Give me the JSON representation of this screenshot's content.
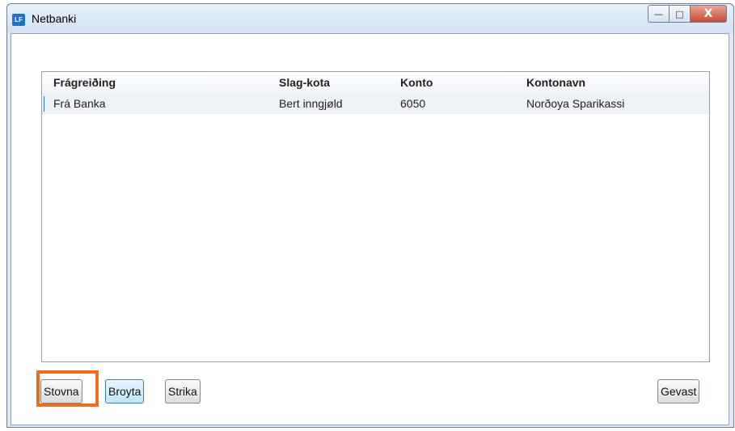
{
  "window": {
    "title": "Netbanki",
    "app_icon_text": "LF",
    "controls": {
      "minimize": "—",
      "maximize": "□",
      "close": "X"
    }
  },
  "grid": {
    "columns": [
      "Frágreiðing",
      "Slag-kota",
      "Konto",
      "Kontonavn"
    ],
    "rows": [
      [
        "Frá Banka",
        "Bert inngjøld",
        "6050",
        "Norðoya Sparikassi"
      ]
    ]
  },
  "buttons": {
    "create": "Stovna",
    "edit": "Broyta",
    "delete": "Strika",
    "save": "Gevast"
  },
  "colors": {
    "highlight": "#f26b1d",
    "accent": "#1e73c8",
    "close_button": "#c74c34"
  }
}
